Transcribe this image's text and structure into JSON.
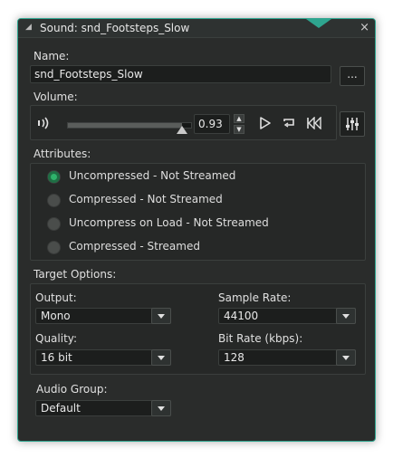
{
  "window": {
    "title": "Sound: snd_Footsteps_Slow",
    "close_glyph": "×"
  },
  "name_section": {
    "label": "Name:",
    "value": "snd_Footsteps_Slow",
    "browse_label": "..."
  },
  "volume_section": {
    "label": "Volume:",
    "slider_fraction": 0.93,
    "value": "0.93"
  },
  "attributes": {
    "label": "Attributes:",
    "options": [
      {
        "label": "Uncompressed - Not Streamed",
        "selected": true
      },
      {
        "label": "Compressed - Not Streamed",
        "selected": false
      },
      {
        "label": "Uncompress on Load - Not Streamed",
        "selected": false
      },
      {
        "label": "Compressed - Streamed",
        "selected": false
      }
    ]
  },
  "target_options": {
    "label": "Target Options:",
    "output": {
      "label": "Output:",
      "value": "Mono"
    },
    "sample_rate": {
      "label": "Sample Rate:",
      "value": "44100"
    },
    "quality": {
      "label": "Quality:",
      "value": "16 bit"
    },
    "bit_rate": {
      "label": "Bit Rate (kbps):",
      "value": "128"
    }
  },
  "audio_group": {
    "label": "Audio Group:",
    "value": "Default"
  },
  "colors": {
    "accent": "#2ea58f",
    "radio_selected": "#2fb36b",
    "background": "#2a2c2b"
  }
}
